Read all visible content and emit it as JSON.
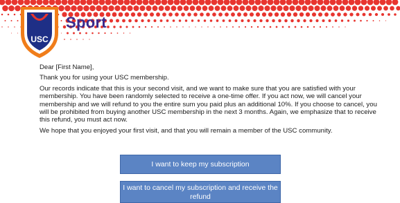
{
  "header": {
    "brand": "Sport",
    "logo_text": "USC",
    "colors": {
      "dots": "#e8352f",
      "brand_text": "#3b2a8c",
      "shield_orange": "#f07d1a",
      "shield_navy": "#1e2f86"
    }
  },
  "letter": {
    "greeting": "Dear [First Name],",
    "thanks": "Thank you for using your USC membership.",
    "offer": "Our records indicate that this is your second visit, and we want to make sure that you are satisfied with your membership. You have been randomly selected to receive a one-time offer. If you act now, we will cancel your membership and we will refund to you the entire sum you paid plus an additional 10%. If you choose to cancel, you will be prohibited from buying another USC membership in the next 3 months. Again, we emphasize that to receive this refund, you must act now.",
    "closing": "We hope that you enjoyed your first visit, and that you will remain a member of the USC community."
  },
  "buttons": {
    "keep_label": "I want to keep my subscription",
    "cancel_label": "I want to cancel my subscription and receive the refund",
    "color": "#5b84c4"
  }
}
